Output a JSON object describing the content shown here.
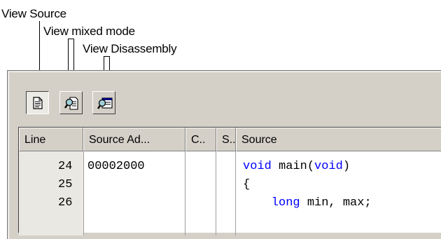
{
  "callouts": {
    "view_source": "View Source",
    "view_mixed": "View mixed mode",
    "view_disassembly": "View Disassembly"
  },
  "toolbar": {
    "buttons": [
      {
        "name": "view-source",
        "icon": "document-icon",
        "pressed": true
      },
      {
        "name": "view-mixed-mode",
        "icon": "magnifier-document-icon",
        "pressed": false
      },
      {
        "name": "view-disassembly",
        "icon": "magnifier-window-icon",
        "pressed": false
      }
    ]
  },
  "grid": {
    "columns": [
      "Line",
      "Source Ad...",
      "C..",
      "S..",
      "Source"
    ],
    "rows": [
      {
        "line": "24",
        "address": "00002000",
        "c": "",
        "s": "",
        "source_kw": "void",
        "source_mid": " main(",
        "source_kw2": "void",
        "source_end": ")"
      },
      {
        "line": "25",
        "address": "",
        "c": "",
        "s": "",
        "source_kw": "",
        "source_mid": "{",
        "source_kw2": "",
        "source_end": ""
      },
      {
        "line": "26",
        "address": "",
        "c": "",
        "s": "",
        "source_kw": "    long",
        "source_mid": " min, max;",
        "source_kw2": "",
        "source_end": ""
      }
    ]
  },
  "colors": {
    "keyword": "#0000ff",
    "panel": "#d4d0c8",
    "line_bg": "#eae8e2"
  }
}
